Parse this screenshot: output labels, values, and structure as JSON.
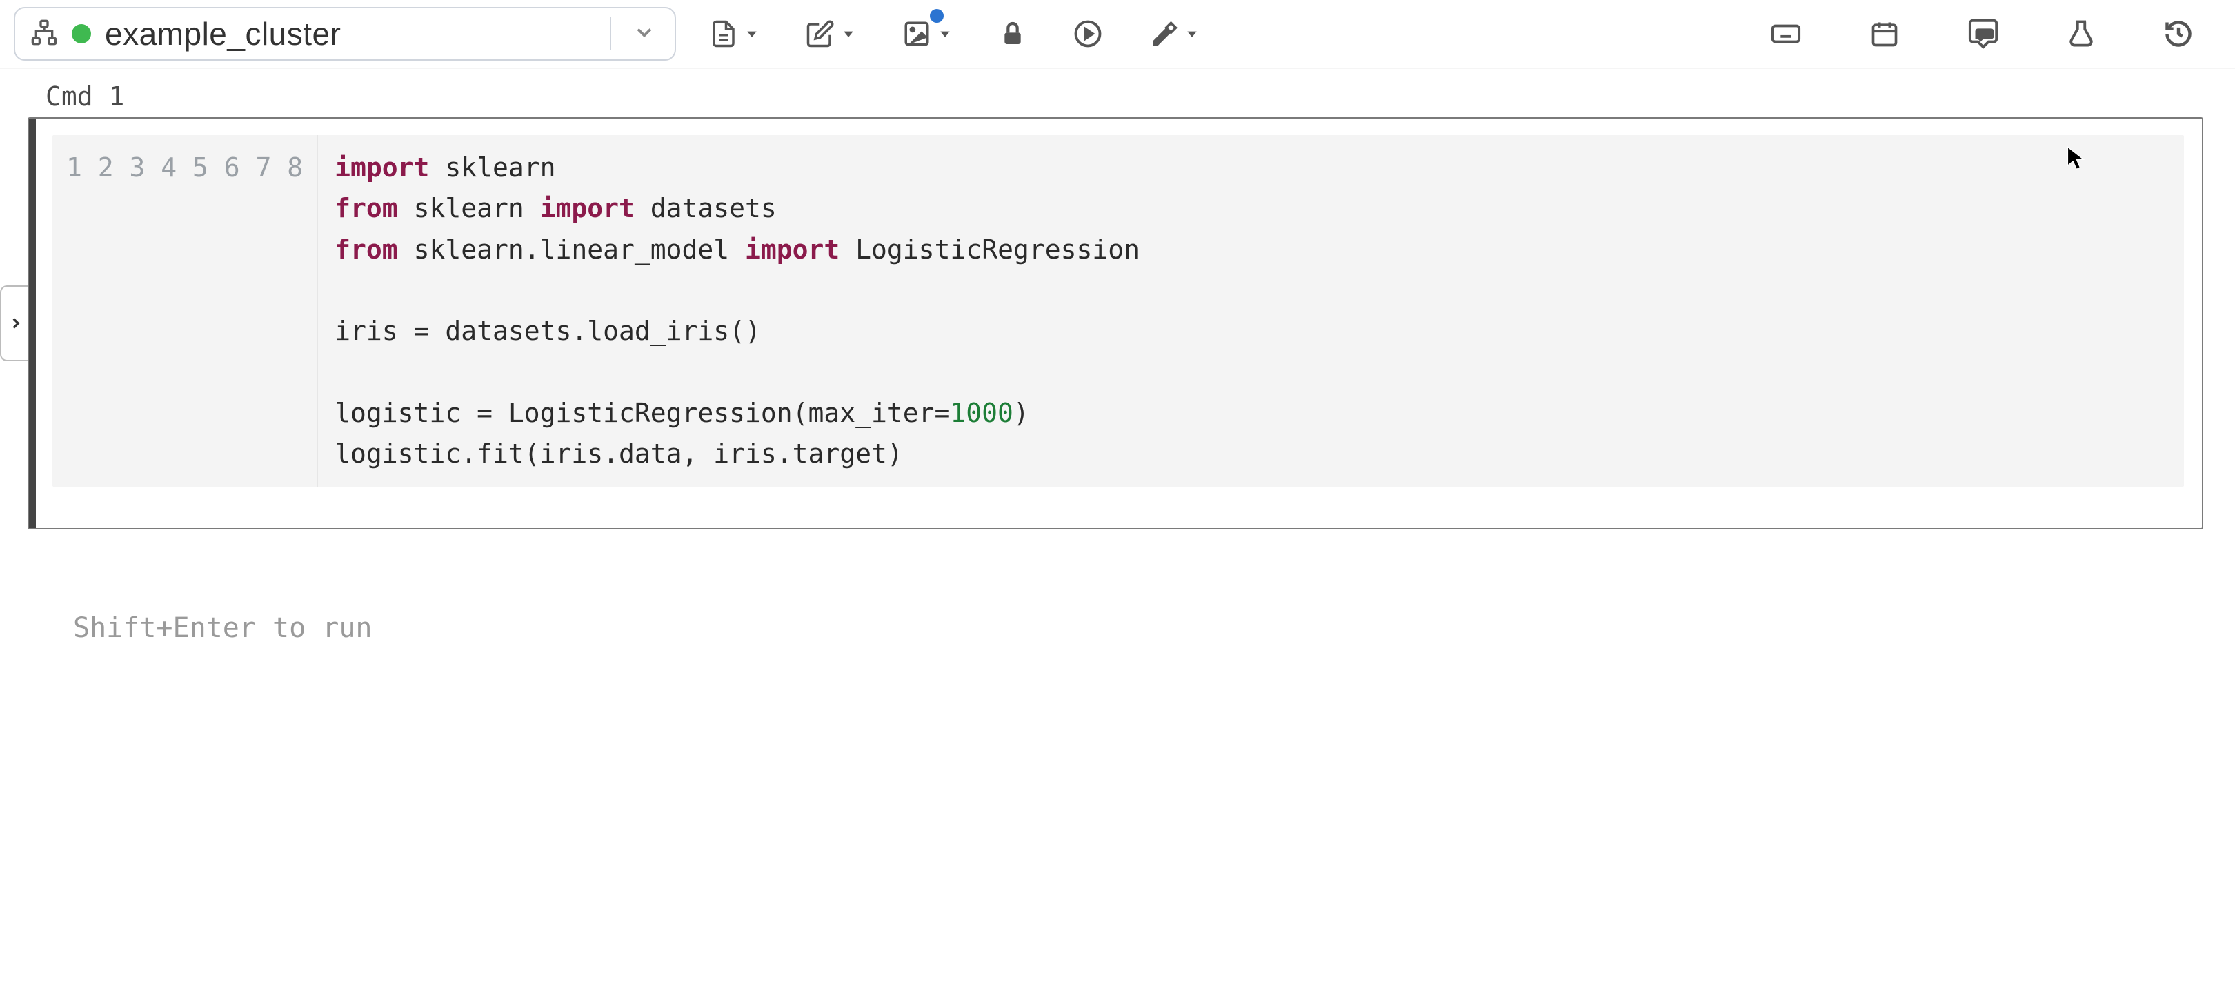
{
  "cluster": {
    "name": "example_cluster",
    "status": "running"
  },
  "toolbar": {
    "sitemap_icon": "sitemap",
    "attach_dropdown": "attach",
    "file_menu": "file",
    "edit_menu": "edit",
    "image_menu": "image",
    "lock": "lock",
    "run_all": "run-all",
    "clear_menu": "clear",
    "keyboard": "keyboard-shortcuts",
    "schedule": "schedule",
    "comments": "comments",
    "experiments": "experiments",
    "revision": "revision-history"
  },
  "cell": {
    "label": "Cmd 1",
    "lines": [
      {
        "n": 1,
        "tokens": [
          {
            "t": "import",
            "c": "kw"
          },
          {
            "t": " sklearn"
          }
        ]
      },
      {
        "n": 2,
        "tokens": [
          {
            "t": "from",
            "c": "kw"
          },
          {
            "t": " sklearn "
          },
          {
            "t": "import",
            "c": "kw"
          },
          {
            "t": " datasets"
          }
        ]
      },
      {
        "n": 3,
        "tokens": [
          {
            "t": "from",
            "c": "kw"
          },
          {
            "t": " sklearn.linear_model "
          },
          {
            "t": "import",
            "c": "kw"
          },
          {
            "t": " LogisticRegression"
          }
        ]
      },
      {
        "n": 4,
        "tokens": [
          {
            "t": ""
          }
        ]
      },
      {
        "n": 5,
        "tokens": [
          {
            "t": "iris = datasets.load_iris()"
          }
        ]
      },
      {
        "n": 6,
        "tokens": [
          {
            "t": ""
          }
        ]
      },
      {
        "n": 7,
        "tokens": [
          {
            "t": "logistic = LogisticRegression(max_iter="
          },
          {
            "t": "1000",
            "c": "num"
          },
          {
            "t": ")"
          }
        ]
      },
      {
        "n": 8,
        "tokens": [
          {
            "t": "logistic.fit(iris.data, iris.target)"
          }
        ]
      }
    ],
    "actions": {
      "run": "run-cell",
      "toggle": "toggle-output",
      "minimize": "minimize-cell",
      "delete": "delete-cell"
    }
  },
  "hint": "Shift+Enter to run"
}
